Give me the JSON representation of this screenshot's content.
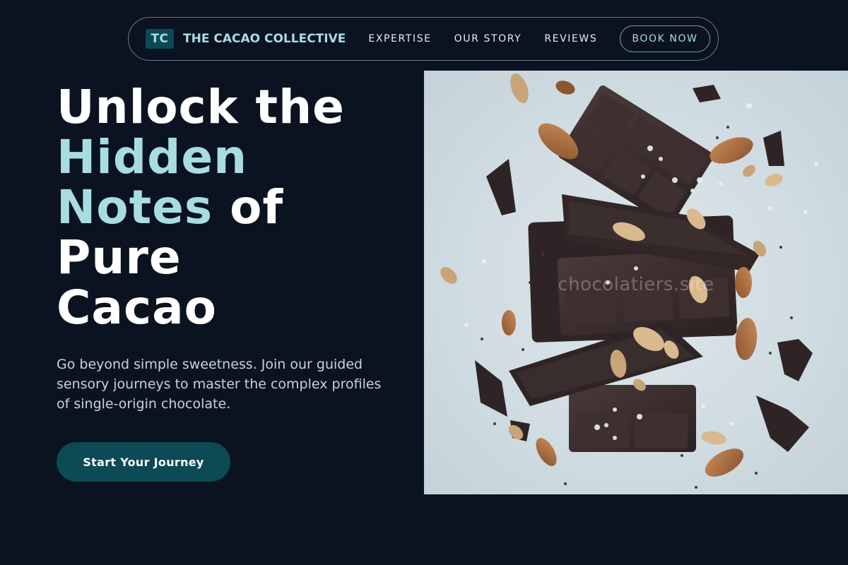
{
  "nav": {
    "logo_mark": "TC",
    "brand_name": "THE CACAO COLLECTIVE",
    "links": [
      {
        "label": "EXPERTISE"
      },
      {
        "label": "OUR STORY"
      },
      {
        "label": "REVIEWS"
      }
    ],
    "book_label": "BOOK NOW"
  },
  "hero": {
    "title_line1": "Unlock the",
    "title_accent": "Hidden Notes",
    "title_of": " of",
    "title_line3": "Pure",
    "title_line4": "Cacao",
    "subtitle": "Go beyond simple sweetness. Join our guided sensory journeys to master the complex profiles of single-origin chocolate.",
    "cta_label": "Start Your Journey",
    "image_watermark": "chocolatiers.site"
  },
  "colors": {
    "background": "#0b1320",
    "accent": "#a8dce3",
    "button": "#0c4a55",
    "text": "#ffffff"
  }
}
